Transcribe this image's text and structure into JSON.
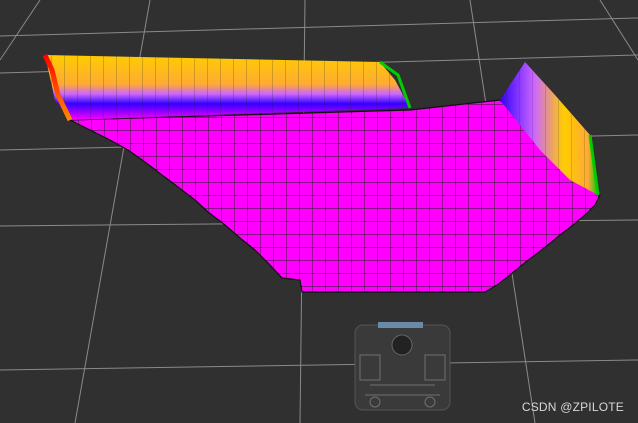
{
  "scene": {
    "background": "#303030",
    "grid_color": "#a0a0a0",
    "costmap_free_color": "#ff00ff",
    "gradient_colors": [
      "#ff0000",
      "#ffcc00",
      "#00cc00",
      "#0000ff",
      "#ff00ff"
    ],
    "robot_color": "#3a3a3a"
  },
  "watermark": {
    "text": "CSDN @ZPILOTE"
  }
}
